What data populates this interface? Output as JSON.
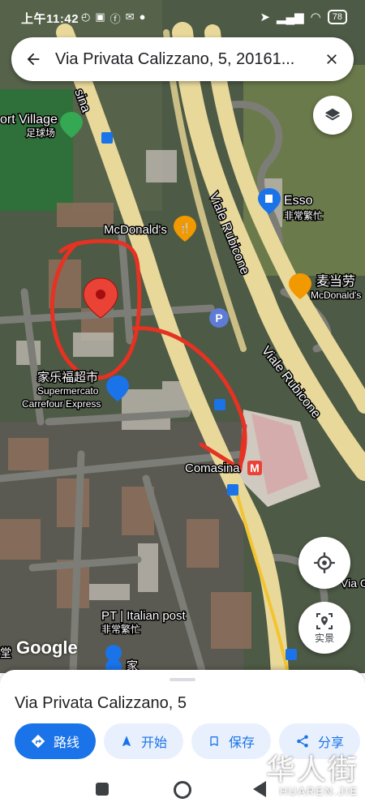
{
  "status_bar": {
    "time": "上午11:42",
    "battery": "78"
  },
  "search": {
    "query": "Via Privata Calizzano, 5, 20161..."
  },
  "map_labels": {
    "sport_village": "ort Village",
    "football_field": "足球场",
    "mcdonalds_left": "McDonald's",
    "esso": "Esso",
    "esso_cn": "非常繁忙",
    "viale_rubicone_1": "Viale Rubicone",
    "viale_rubicone_2": "Viale Rubicone",
    "mcdonalds_cn": "麦当劳",
    "mcdonalds_right": "McDonald's",
    "supermarket_cn": "家乐福超市",
    "supermarket_it": "Supermercato",
    "supermarket_en": "Carrefour Express",
    "comasina": "Comasina",
    "metro_badge": "M",
    "comasina_road": "sina",
    "post_office": "PT | Italian post",
    "post_office_cn": "非常繁忙",
    "via_right": "Via G",
    "left_edge": "堂",
    "bottom_cn": "家",
    "parking_badge": "P"
  },
  "google_logo": "Google",
  "buttons": {
    "street_view_label": "实景"
  },
  "place": {
    "title": "Via Privata Calizzano, 5"
  },
  "actions": {
    "directions": "路线",
    "start": "开始",
    "save": "保存",
    "share": "分享"
  },
  "watermark": {
    "cn": "华人街",
    "en": "HUAREN.JIE"
  },
  "colors": {
    "primary": "#1a73e8",
    "pin": "#ea4335",
    "annotation": "#e53222",
    "highway": "#e8d89a"
  }
}
